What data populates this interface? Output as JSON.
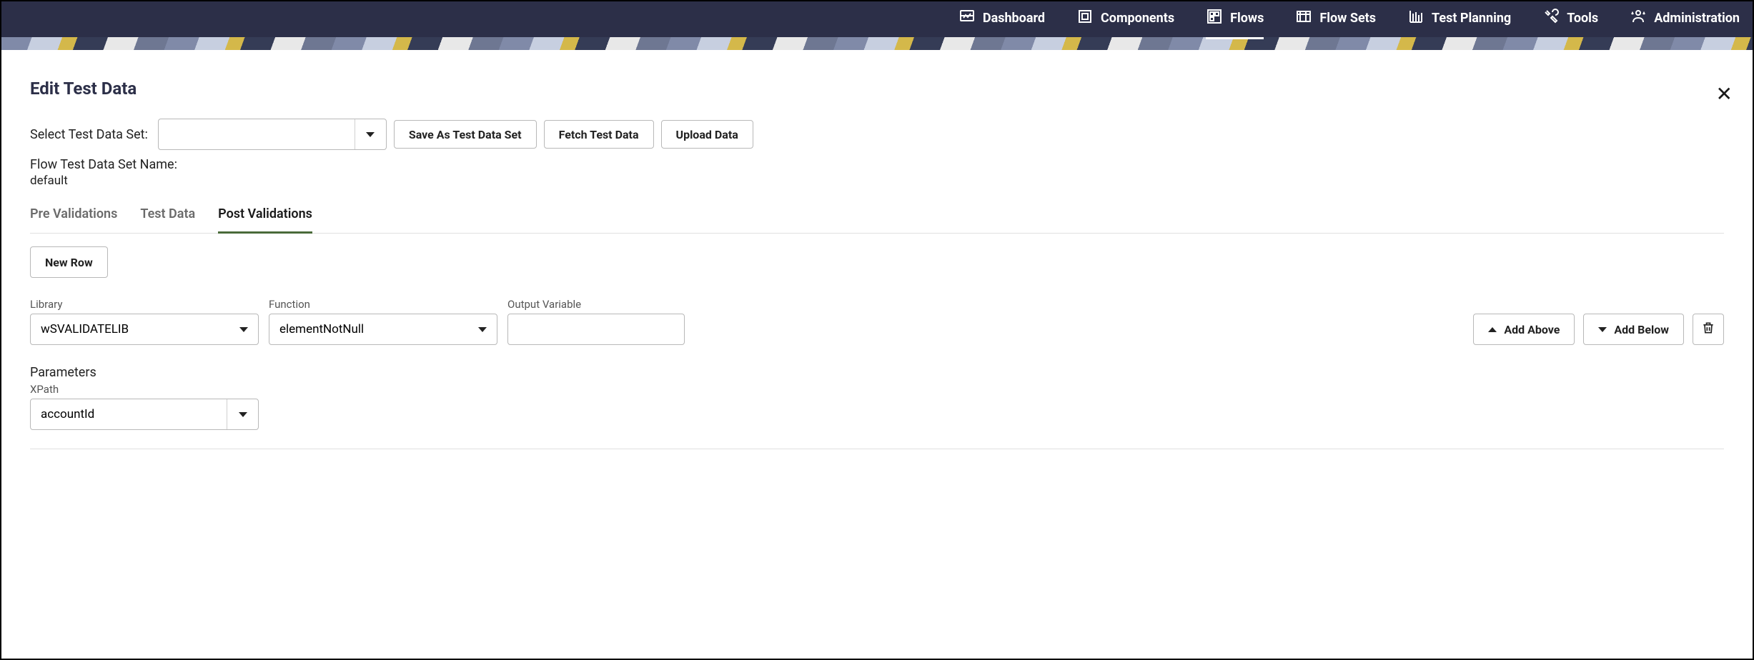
{
  "nav": {
    "items": [
      {
        "label": "Dashboard",
        "active": false
      },
      {
        "label": "Components",
        "active": false
      },
      {
        "label": "Flows",
        "active": true
      },
      {
        "label": "Flow Sets",
        "active": false
      },
      {
        "label": "Test Planning",
        "active": false
      },
      {
        "label": "Tools",
        "active": false
      },
      {
        "label": "Administration",
        "active": false
      }
    ]
  },
  "page": {
    "title": "Edit Test Data",
    "select_label": "Select Test Data Set:",
    "dataset_value": "",
    "save_as_btn": "Save As Test Data Set",
    "fetch_btn": "Fetch Test Data",
    "upload_btn": "Upload Data",
    "flow_set_name_label": "Flow Test Data Set Name:",
    "flow_set_name_value": "default"
  },
  "tabs": [
    {
      "label": "Pre Validations",
      "active": false
    },
    {
      "label": "Test Data",
      "active": false
    },
    {
      "label": "Post Validations",
      "active": true
    }
  ],
  "actions": {
    "new_row": "New Row",
    "add_above": "Add Above",
    "add_below": "Add Below"
  },
  "row": {
    "library_label": "Library",
    "library_value": "wSVALIDATELIB",
    "function_label": "Function",
    "function_value": "elementNotNull",
    "output_label": "Output Variable",
    "output_value": ""
  },
  "params": {
    "heading": "Parameters",
    "xpath_label": "XPath",
    "xpath_value": "accountId"
  }
}
